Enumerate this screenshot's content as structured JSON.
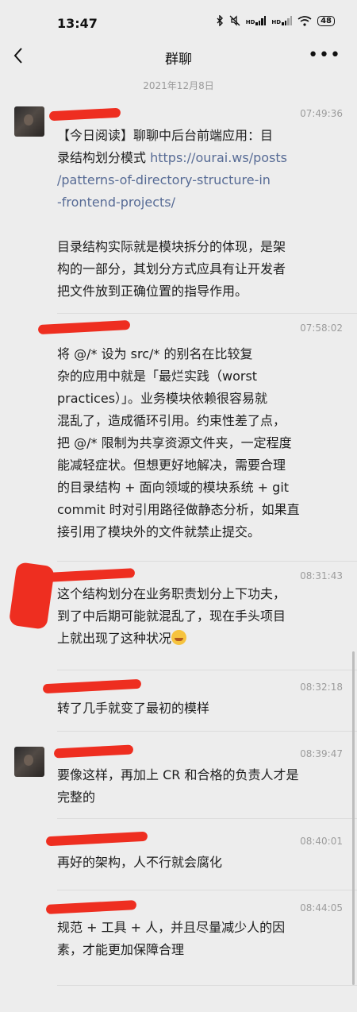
{
  "status": {
    "time": "13:47",
    "battery": "48"
  },
  "nav": {
    "title": "群聊"
  },
  "date_separator": "2021年12月8日",
  "messages": [
    {
      "time": "07:49:36",
      "text_prefix": "【今日阅读】聊聊中后台前端应用：目\n录结构划分模式 ",
      "link": "https://ourai.ws/posts\n/patterns-of-directory-structure-in\n-frontend-projects/",
      "text_suffix": "\n\n目录结构实际就是模块拆分的体现，是架\n构的一部分，其划分方式应具有让开发者\n把文件放到正确位置的指导作用。"
    },
    {
      "time": "07:58:02",
      "text": "将 @/* 设为 src/* 的别名在比较复\n杂的应用中就是「最烂实践（worst\npractices）」。业务模块依赖很容易就\n混乱了，造成循环引用。约束性差了点，\n把 @/* 限制为共享资源文件夹，一定程度\n能减轻症状。但想更好地解决，需要合理\n的目录结构 + 面向领域的模块系统 + git\ncommit 时对引用路径做静态分析，如果直\n接引用了模块外的文件就禁止提交。"
    },
    {
      "time": "08:31:43",
      "text": "这个结构划分在业务职责划分上下功夫，\n到了中后期可能就混乱了，现在手头项目\n上就出现了这种状况"
    },
    {
      "time": "08:32:18",
      "text": "转了几手就变了最初的模样"
    },
    {
      "time": "08:39:47",
      "text": "要像这样，再加上 CR 和合格的负责人才是\n完整的"
    },
    {
      "time": "08:40:01",
      "text": "再好的架构，人不行就会腐化"
    },
    {
      "time": "08:44:05",
      "text": "规范 + 工具 + 人，并且尽量减少人的因\n素，才能更加保障合理"
    }
  ],
  "colors": {
    "background": "#ededed",
    "link": "#576b95",
    "redaction": "#ee2e20"
  }
}
